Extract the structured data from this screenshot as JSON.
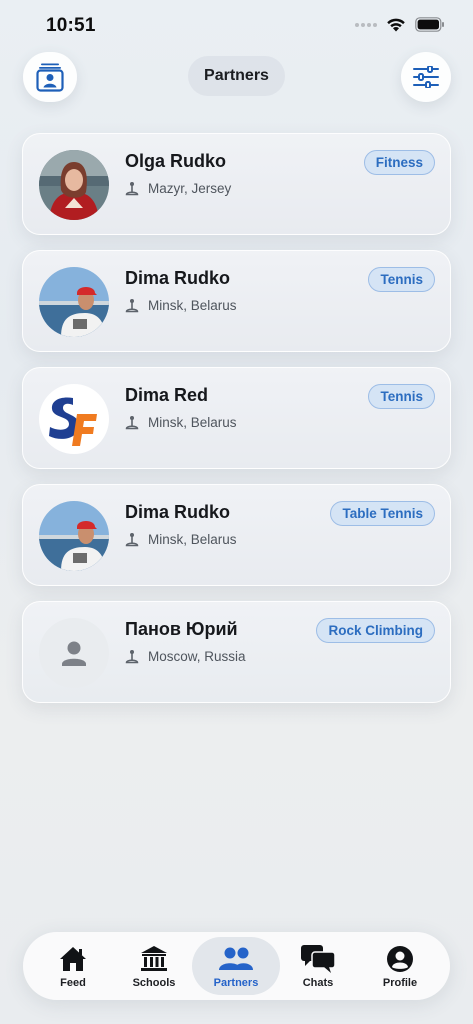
{
  "status_bar": {
    "time": "10:51"
  },
  "header": {
    "title": "Partners"
  },
  "colors": {
    "accent": "#2563c9",
    "tag_bg": "#d5e4f5",
    "tag_border": "#9dbde6"
  },
  "partners": [
    {
      "name": "Olga Rudko",
      "location": "Mazyr, Jersey",
      "sport": "Fitness",
      "avatar": "photo"
    },
    {
      "name": "Dima Rudko",
      "location": "Minsk, Belarus",
      "sport": "Tennis",
      "avatar": "photo"
    },
    {
      "name": "Dima Red",
      "location": "Minsk, Belarus",
      "sport": "Tennis",
      "avatar": "logo"
    },
    {
      "name": "Dima Rudko",
      "location": "Minsk, Belarus",
      "sport": "Table Tennis",
      "avatar": "photo"
    },
    {
      "name": "Панов Юрий",
      "location": "Moscow, Russia",
      "sport": "Rock Climbing",
      "avatar": "placeholder"
    }
  ],
  "tabs": [
    {
      "label": "Feed",
      "icon": "house-icon",
      "active": false
    },
    {
      "label": "Schools",
      "icon": "bank-icon",
      "active": false
    },
    {
      "label": "Partners",
      "icon": "people-icon",
      "active": true
    },
    {
      "label": "Chats",
      "icon": "chat-bubbles-icon",
      "active": false
    },
    {
      "label": "Profile",
      "icon": "person-circle-icon",
      "active": false
    }
  ]
}
